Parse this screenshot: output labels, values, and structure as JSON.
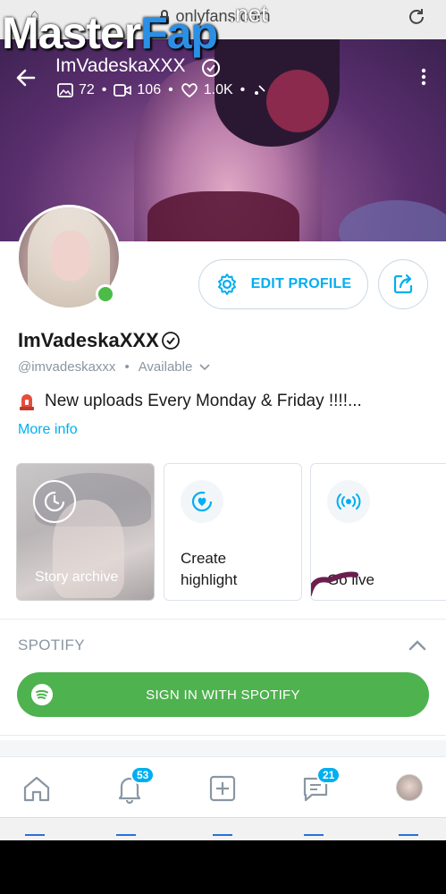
{
  "browser": {
    "url": "onlyfans.com"
  },
  "watermark": {
    "part1": "Master",
    "part2": "Fap",
    "suffix": ".net"
  },
  "cover": {
    "title": "ImVadeskaXXX",
    "stats": {
      "images": "72",
      "videos": "106",
      "likes": "1.0K"
    }
  },
  "profile": {
    "edit_label": "EDIT PROFILE",
    "name": "ImVadeskaXXX",
    "handle": "@imvadeskaxxx",
    "status": "Available",
    "bio": "New uploads Every Monday & Friday !!!!...",
    "more_info": "More info"
  },
  "cards": {
    "story_archive": "Story archive",
    "create_highlight_line1": "Create",
    "create_highlight_line2": "highlight",
    "go_live": "Go live"
  },
  "spotify": {
    "section_title": "SPOTIFY",
    "button_label": "SIGN IN WITH SPOTIFY"
  },
  "nav": {
    "notifications_badge": "53",
    "messages_badge": "21"
  },
  "colors": {
    "accent": "#00aff0",
    "spotify_green": "#4eb24f",
    "online": "#4cbb48"
  }
}
